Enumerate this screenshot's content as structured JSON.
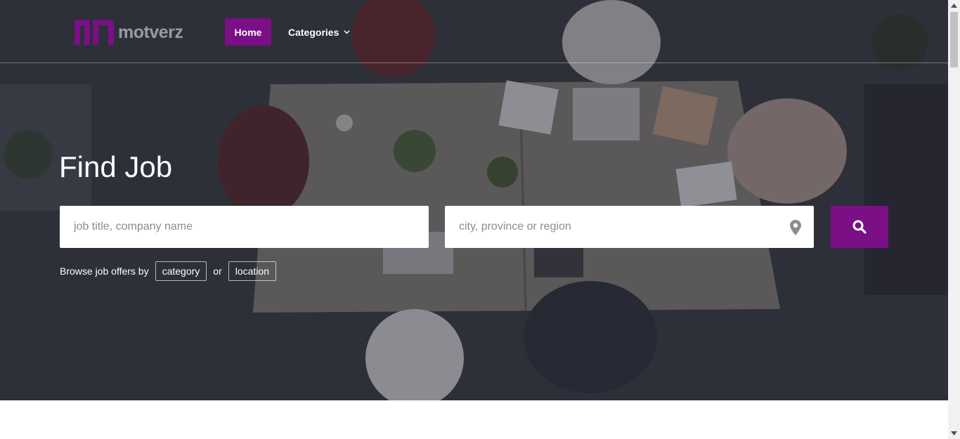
{
  "header": {
    "logo_text": "motverz",
    "nav": {
      "home_label": "Home",
      "categories_label": "Categories"
    }
  },
  "hero": {
    "title": "Find Job",
    "search": {
      "job_placeholder": "job title, company name",
      "location_placeholder": "city, province or region"
    },
    "browse": {
      "prefix": "Browse job offers by",
      "category_label": "category",
      "or_label": "or",
      "location_label": "location"
    }
  },
  "colors": {
    "brand": "#7a0f86",
    "hero_overlay": "#1e202a"
  },
  "icons": {
    "logo": "motverz-logo-mark",
    "chevron": "chevron-down-icon",
    "pin": "map-pin-icon",
    "search": "search-icon"
  }
}
